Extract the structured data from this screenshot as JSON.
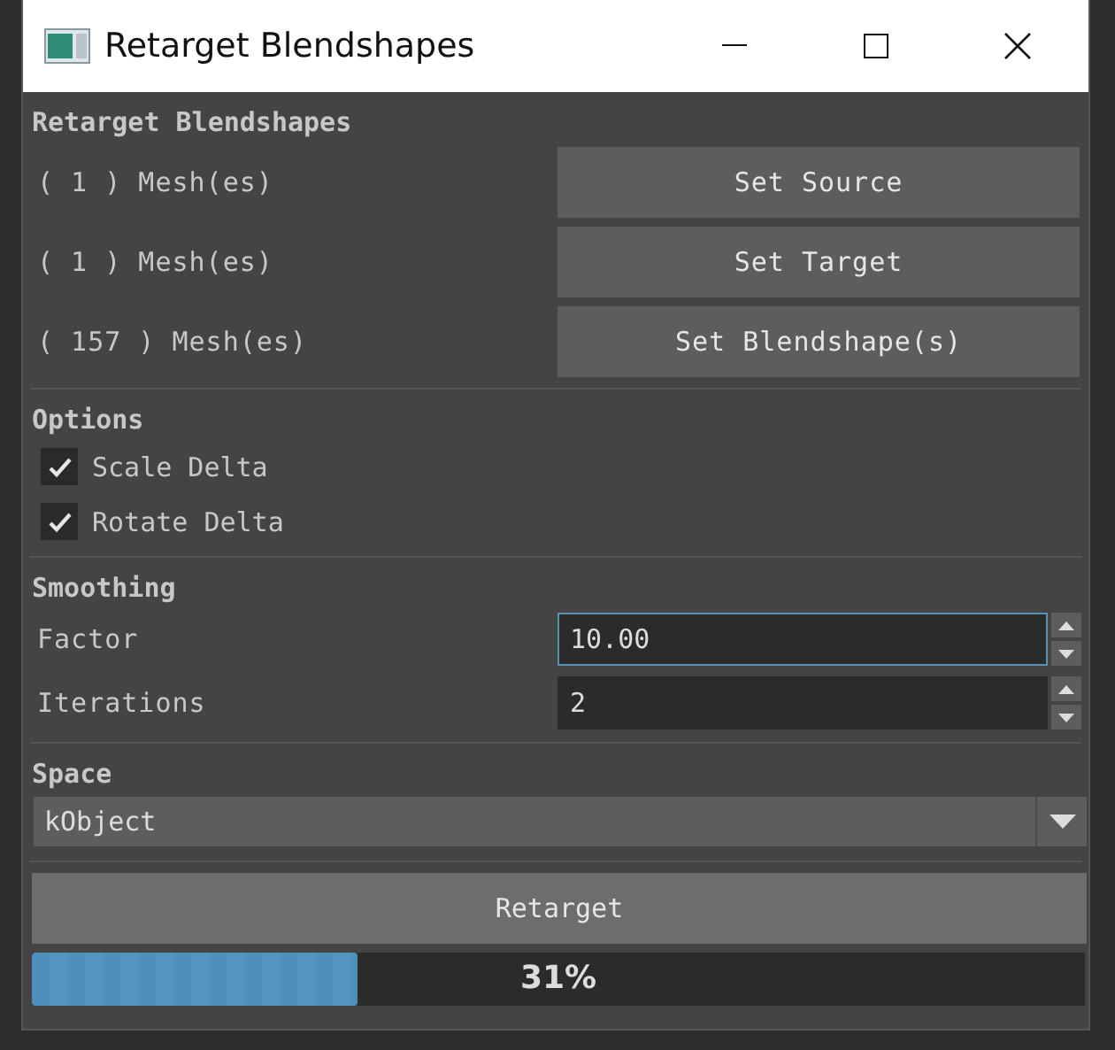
{
  "window": {
    "title": "Retarget Blendshapes"
  },
  "retarget": {
    "heading": "Retarget Blendshapes",
    "rows": [
      {
        "count": "( 1 ) Mesh(es)",
        "button": "Set Source"
      },
      {
        "count": "( 1 ) Mesh(es)",
        "button": "Set Target"
      },
      {
        "count": "( 157 ) Mesh(es)",
        "button": "Set Blendshape(s)"
      }
    ]
  },
  "options": {
    "heading": "Options",
    "items": [
      {
        "label": "Scale Delta",
        "checked": true
      },
      {
        "label": "Rotate Delta",
        "checked": true
      }
    ]
  },
  "smoothing": {
    "heading": "Smoothing",
    "fields": [
      {
        "label": "Factor",
        "value": "10.00",
        "focused": true
      },
      {
        "label": "Iterations",
        "value": "2",
        "focused": false
      }
    ]
  },
  "space": {
    "heading": "Space",
    "value": "kObject"
  },
  "retarget_button": "Retarget",
  "progress": {
    "level": 0.31,
    "reading": "31%"
  }
}
